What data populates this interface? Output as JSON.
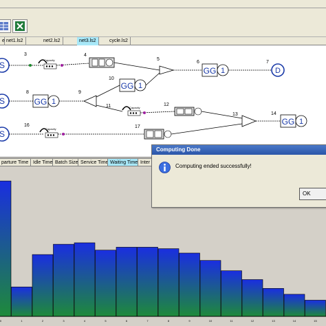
{
  "file_tabs": [
    {
      "label": "e",
      "active": false
    },
    {
      "label": "net1.ls2",
      "active": false
    },
    {
      "label": "net2.ls2",
      "active": false
    },
    {
      "label": "net3.ls2",
      "active": true
    },
    {
      "label": "cycle.ls2",
      "active": false
    }
  ],
  "network": {
    "source_label": "S",
    "sink_label": "D",
    "server_label": "GG",
    "server_count": "1",
    "capacity_label": "Capacity",
    "node_numbers": [
      "3",
      "4",
      "5",
      "6",
      "7",
      "8",
      "9",
      "10",
      "11",
      "12",
      "13",
      "14",
      "16",
      "17"
    ]
  },
  "chart_tabs": [
    {
      "label": "parture Time",
      "active": false
    },
    {
      "label": "Idle Time",
      "active": false
    },
    {
      "label": "Batch Size",
      "active": false
    },
    {
      "label": "Service Time",
      "active": false
    },
    {
      "label": "Waiting Time",
      "active": true
    },
    {
      "label": "Inter",
      "active": false
    }
  ],
  "dialog": {
    "title": "Computing Done",
    "message": "Computing ended successfully!",
    "ok_label": "OK"
  },
  "chart_data": {
    "type": "bar",
    "categories": [
      "0",
      "1",
      "2",
      "3",
      "4",
      "5",
      "6",
      "7",
      "8",
      "9",
      "10",
      "11",
      "12",
      "13",
      "14",
      "15"
    ],
    "values": [
      0.92,
      0.2,
      0.42,
      0.49,
      0.5,
      0.45,
      0.47,
      0.47,
      0.46,
      0.43,
      0.38,
      0.31,
      0.25,
      0.19,
      0.15,
      0.11
    ],
    "bar_color_top": "#1a2ee0",
    "bar_color_bottom": "#1e8a3a",
    "ylim": [
      0,
      1
    ]
  }
}
